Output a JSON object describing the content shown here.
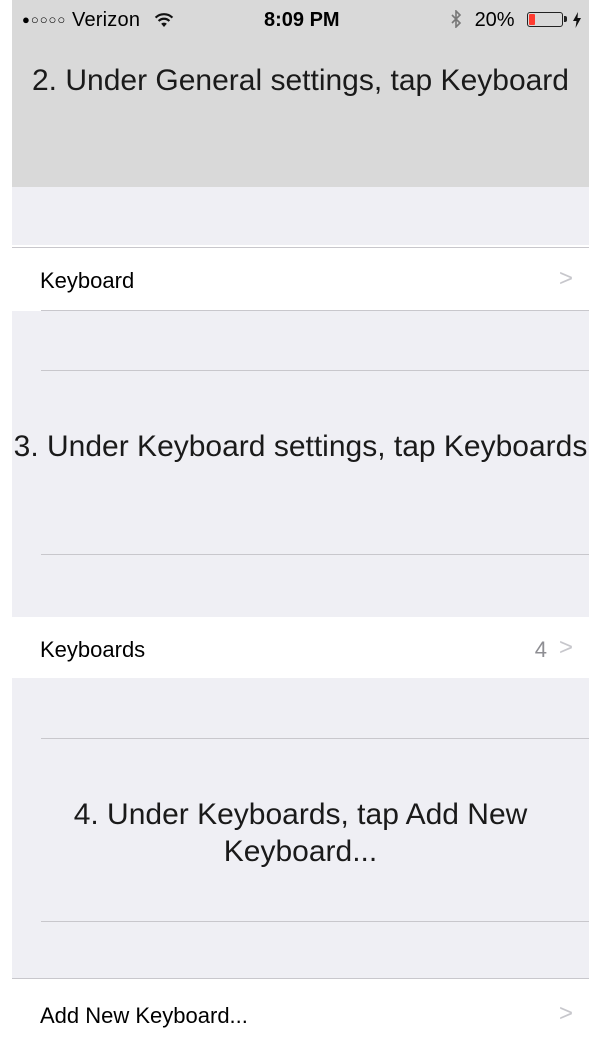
{
  "status_bar": {
    "signal": "●○○○○",
    "carrier": "Verizon",
    "time": "8:09 PM",
    "battery": "20%",
    "battery_level": 0.2,
    "battery_color": "#ff3b30"
  },
  "steps": {
    "step2": "2. Under General settings, tap Keyboard",
    "step3": "3. Under Keyboard settings, tap Keyboards",
    "step4": "4. Under Keyboards, tap Add New Keyboard..."
  },
  "rows": {
    "keyboard": {
      "label": "Keyboard",
      "chevron": ">"
    },
    "keyboards": {
      "label": "Keyboards",
      "detail": "4",
      "chevron": ">"
    },
    "add_new": {
      "label": "Add New Keyboard...",
      "chevron": ">"
    }
  },
  "colors": {
    "header_bg": "#d9d9d9",
    "group_bg": "#efeff4",
    "separator": "#c8c7cc",
    "chevron": "#c7c7cc"
  }
}
